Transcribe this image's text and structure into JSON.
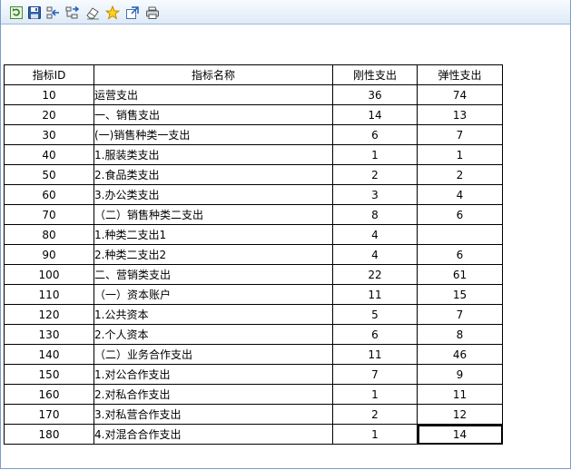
{
  "toolbar": {
    "buttons": [
      {
        "name": "refresh-icon"
      },
      {
        "name": "save-icon"
      },
      {
        "name": "insert-row-icon"
      },
      {
        "name": "insert-child-icon"
      },
      {
        "name": "eraser-icon"
      },
      {
        "name": "star-icon"
      },
      {
        "name": "export-icon"
      },
      {
        "name": "print-icon"
      }
    ]
  },
  "table": {
    "columns": [
      "指标ID",
      "指标名称",
      "刚性支出",
      "弹性支出"
    ],
    "rows": [
      {
        "id": "10",
        "name": "运营支出",
        "level": 0,
        "rigid": "36",
        "elastic": "74"
      },
      {
        "id": "20",
        "name": "一、销售支出",
        "level": 1,
        "rigid": "14",
        "elastic": "13"
      },
      {
        "id": "30",
        "name": "(一)销售种类一支出",
        "level": 2,
        "rigid": "6",
        "elastic": "7"
      },
      {
        "id": "40",
        "name": "1.服装类支出",
        "level": 3,
        "rigid": "1",
        "elastic": "1"
      },
      {
        "id": "50",
        "name": "2.食品类支出",
        "level": 3,
        "rigid": "2",
        "elastic": "2"
      },
      {
        "id": "60",
        "name": "3.办公类支出",
        "level": 3,
        "rigid": "3",
        "elastic": "4"
      },
      {
        "id": "70",
        "name": "（二）销售种类二支出",
        "level": 2,
        "rigid": "8",
        "elastic": "6"
      },
      {
        "id": "80",
        "name": "1.种类二支出1",
        "level": 3,
        "rigid": "4",
        "elastic": ""
      },
      {
        "id": "90",
        "name": "2.种类二支出2",
        "level": 3,
        "rigid": "4",
        "elastic": "6"
      },
      {
        "id": "100",
        "name": "二、营销类支出",
        "level": 1,
        "rigid": "22",
        "elastic": "61"
      },
      {
        "id": "110",
        "name": "（一）资本账户",
        "level": 2,
        "rigid": "11",
        "elastic": "15"
      },
      {
        "id": "120",
        "name": "1.公共资本",
        "level": 3,
        "rigid": "5",
        "elastic": "7"
      },
      {
        "id": "130",
        "name": "2.个人资本",
        "level": 3,
        "rigid": "6",
        "elastic": "8"
      },
      {
        "id": "140",
        "name": "（二）业务合作支出",
        "level": 2,
        "rigid": "11",
        "elastic": "46"
      },
      {
        "id": "150",
        "name": "1.对公合作支出",
        "level": 3,
        "rigid": "7",
        "elastic": "9"
      },
      {
        "id": "160",
        "name": "2.对私合作支出",
        "level": 3,
        "rigid": "1",
        "elastic": "11"
      },
      {
        "id": "170",
        "name": "3.对私营合作支出",
        "level": 3,
        "rigid": "2",
        "elastic": "12"
      },
      {
        "id": "180",
        "name": "4.对混合合作支出",
        "level": 3,
        "rigid": "1",
        "elastic": "14"
      }
    ],
    "selected_cell": {
      "row": 17,
      "column": "elastic"
    }
  }
}
